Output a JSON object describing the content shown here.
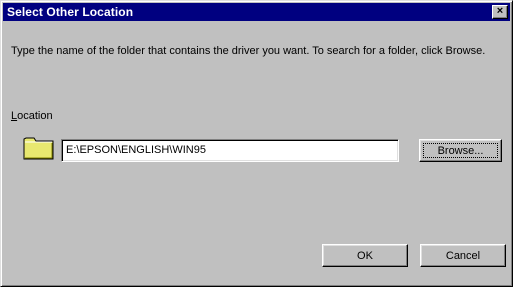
{
  "window": {
    "title": "Select Other Location",
    "close_glyph": "×"
  },
  "instructions": "Type the name of the folder that contains the driver you want. To search for a folder, click Browse.",
  "location": {
    "label_accel": "L",
    "label_rest": "ocation",
    "path_value": "E:\\EPSON\\ENGLISH\\WIN95",
    "icon": "folder-icon"
  },
  "buttons": {
    "browse": "Browse...",
    "ok": "OK",
    "cancel": "Cancel"
  },
  "colors": {
    "titlebar": "#000080",
    "face": "#c0c0c0",
    "folder": "#e8e870"
  }
}
